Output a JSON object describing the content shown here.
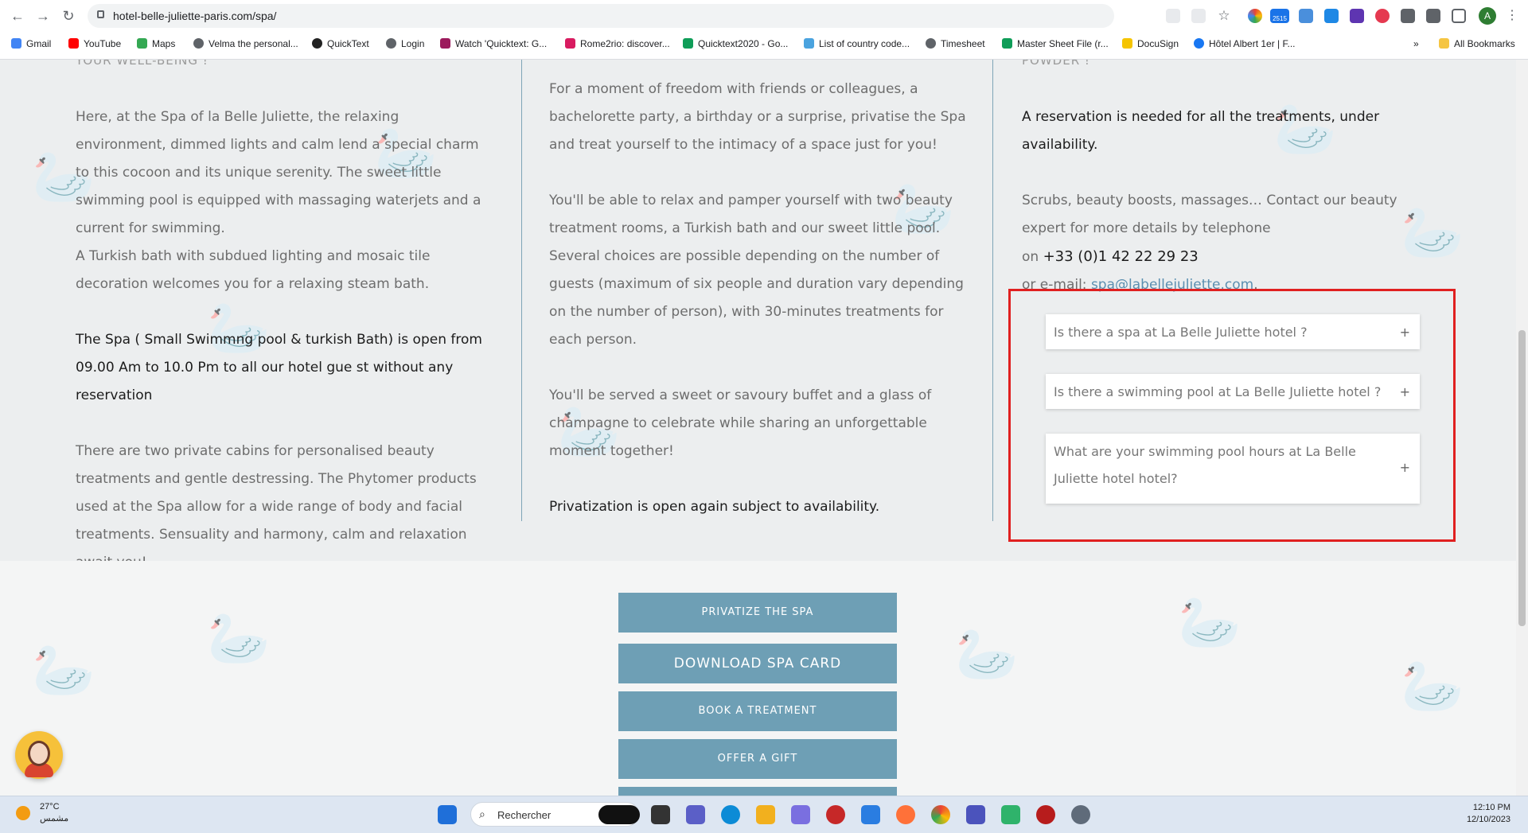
{
  "browser": {
    "url": "hotel-belle-juliette-paris.com/spa/",
    "bookmarks": [
      "Gmail",
      "YouTube",
      "Maps",
      "Velma the personal...",
      "QuickText",
      "Login",
      "Watch 'Quicktext: G...",
      "Rome2rio: discover...",
      "Quicktext2020 - Go...",
      "List of country code...",
      "Timesheet",
      "Master Sheet File (r...",
      "DocuSign",
      "Hôtel Albert 1er | F..."
    ],
    "more_bookmarks": "»",
    "all_bookmarks": "All Bookmarks",
    "profile_initial": "A",
    "ext_badge": "2515"
  },
  "columns": {
    "col1": {
      "peek_heading": "YOUR WELL-BEING !",
      "p1": "Here, at the Spa of la Belle Juliette, the relaxing environment, dimmed lights and calm lend a special charm to this cocoon and its unique serenity. The sweet little swimming pool is equipped with massaging waterjets and a current for swimming.",
      "p1b": "A Turkish bath with subdued lighting and mosaic tile decoration welcomes you for a relaxing steam bath.",
      "p2": "The Spa ( Small Swimmng pool & turkish Bath) is open from 09.00 Am to 10.0 Pm to all our hotel gue st without any reservation",
      "p3": "There are two private cabins for personalised beauty treatments and gentle destressing. The Phytomer products used at the Spa allow for a wide range of body and facial treatments. Sensuality and harmony, calm and relaxation await you!"
    },
    "col2": {
      "p1": "For a moment of freedom with friends or colleagues, a bachelorette party, a birthday or a surprise, privatise the Spa and treat yourself to the intimacy of a space just for you!",
      "p2": "You'll be able to relax and pamper yourself with two beauty treatment rooms, a Turkish bath and our sweet little pool. Several choices are possible depending on the number of guests (maximum of six people and duration vary depending on the number of person), with 30-minutes treatments for each person.",
      "p3": "You'll be served a sweet or savoury buffet and a glass of champagne to celebrate while sharing an unforgettable moment together!",
      "p4": "Privatization is open again subject to availability."
    },
    "col3": {
      "peek_heading": "POWDER !",
      "p1": "A reservation is needed for all the treatments, under availability.",
      "p2": "Scrubs, beauty boosts, massages… Contact our beauty expert for more details by telephone",
      "phone_prefix": "on",
      "phone": "+33 (0)1 42 22 29 23",
      "email_prefix": "or e-mail:",
      "email": "spa@labellejuliette.com",
      "email_suffix": "."
    }
  },
  "faq": [
    {
      "question": "Is there a spa at La Belle Juliette hotel ?",
      "toggle": "+"
    },
    {
      "question": "Is there a swimming pool at La Belle Juliette hotel ?",
      "toggle": "+"
    },
    {
      "question": "What are your swimming pool hours at La Belle Juliette hotel hotel?",
      "toggle": "+"
    }
  ],
  "buttons": [
    "PRIVATIZE THE SPA",
    "DOWNLOAD SPA CARD",
    "BOOK A TREATMENT",
    "OFFER A GIFT"
  ],
  "taskbar": {
    "temperature": "27°C",
    "weather": "مشمس",
    "search_placeholder": "Rechercher",
    "time": "12:10 PM",
    "date": "12/10/2023"
  },
  "colors": {
    "accent": "#6e9fb5",
    "highlight": "#e02020",
    "link": "#5b8fb0"
  }
}
